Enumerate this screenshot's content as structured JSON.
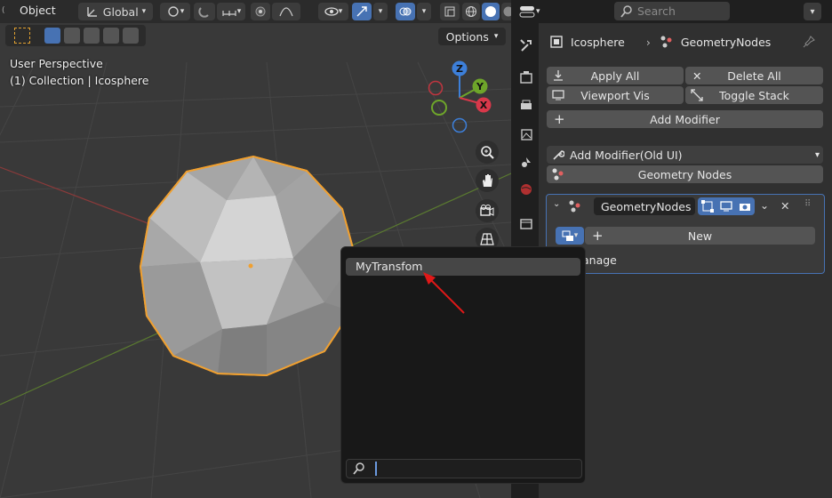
{
  "viewport": {
    "menu_object": "Object",
    "orientation": "Global",
    "options": "Options",
    "view_name": "User Perspective",
    "collection_info": "(1) Collection | Icosphere",
    "gizmo": {
      "z": "Z",
      "y": "Y",
      "x": "X"
    }
  },
  "topbar": {
    "search_placeholder": "Search"
  },
  "properties": {
    "breadcrumb_object": "Icosphere",
    "breadcrumb_modifier": "GeometryNodes",
    "apply_all": "Apply All",
    "delete_all": "Delete All",
    "viewport_vis": "Viewport Vis",
    "toggle_stack": "Toggle Stack",
    "add_modifier": "Add Modifier",
    "add_modifier_old": "Add Modifier(Old UI)",
    "geometry_nodes": "Geometry Nodes",
    "modifier_name": "GeometryNodes",
    "new_label": "New",
    "manage_label": "anage"
  },
  "popup": {
    "items": [
      "MyTransfom"
    ],
    "search_value": ""
  },
  "colors": {
    "accent": "#4772b3",
    "selection_outline": "#f0a030",
    "arrow": "#e01818"
  }
}
